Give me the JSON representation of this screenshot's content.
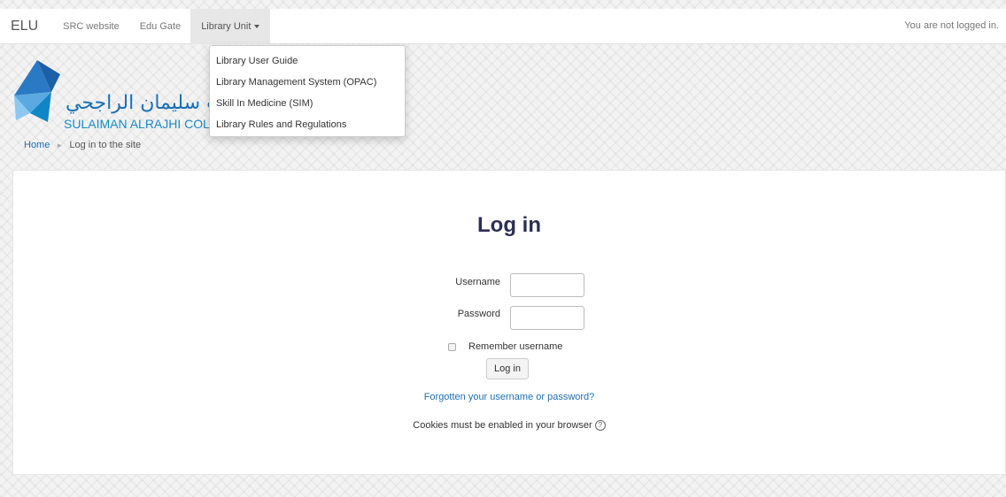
{
  "navbar": {
    "brand": "ELU",
    "links": [
      "SRC website",
      "Edu Gate"
    ],
    "dropdown_label": "Library Unit",
    "login_status": "You are not logged in."
  },
  "dropdown": {
    "items": [
      "Library User Guide",
      "Library Management System (OPAC)",
      "Skill In Medicine (SIM)",
      "Library Rules and Regulations"
    ]
  },
  "header": {
    "logo_arabic": "ت سليمان الراجحي",
    "logo_english": "SULAIMAN ALRAJHI COLL"
  },
  "breadcrumb": {
    "home": "Home",
    "current": "Log in to the site"
  },
  "login": {
    "title": "Log in",
    "username_label": "Username",
    "password_label": "Password",
    "remember_label": "Remember username",
    "button_label": "Log in",
    "forgot_link": "Forgotten your username or password?",
    "cookies_notice": "Cookies must be enabled in your browser"
  },
  "colors": {
    "accent_blue": "#1f6fb5",
    "title": "#2c2f54",
    "logo_blue": "#1a6fb6"
  },
  "icons": [
    "logo-triangles-icon",
    "breadcrumb-separator-icon",
    "caret-down-icon",
    "help-icon"
  ]
}
